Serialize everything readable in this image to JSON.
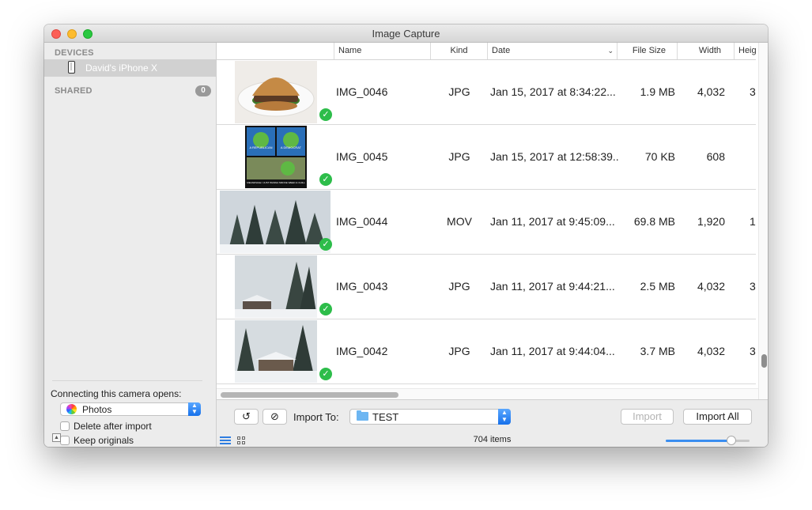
{
  "window": {
    "title": "Image Capture"
  },
  "sidebar": {
    "devices_heading": "DEVICES",
    "device_name": "David's iPhone X",
    "shared_heading": "SHARED",
    "shared_count": "0",
    "opens_label": "Connecting this camera opens:",
    "opens_app": "Photos",
    "delete_after_import": "Delete after import",
    "keep_originals": "Keep originals"
  },
  "table": {
    "columns": [
      "Name",
      "Kind",
      "Date",
      "File Size",
      "Width",
      "Heig"
    ],
    "rows": [
      {
        "name": "IMG_0046",
        "kind": "JPG",
        "date": "Jan 15, 2017 at 8:34:22...",
        "size": "1.9 MB",
        "width": "4,032",
        "height": "3"
      },
      {
        "name": "IMG_0045",
        "kind": "JPG",
        "date": "Jan 15, 2017 at 12:58:39...",
        "size": "70 KB",
        "width": "608",
        "height": ""
      },
      {
        "name": "IMG_0044",
        "kind": "MOV",
        "date": "Jan 11, 2017 at 9:45:09...",
        "size": "69.8 MB",
        "width": "1,920",
        "height": "1"
      },
      {
        "name": "IMG_0043",
        "kind": "JPG",
        "date": "Jan 11, 2017 at 9:44:21...",
        "size": "2.5 MB",
        "width": "4,032",
        "height": "3"
      },
      {
        "name": "IMG_0042",
        "kind": "JPG",
        "date": "Jan 11, 2017 at 9:44:04...",
        "size": "3.7 MB",
        "width": "4,032",
        "height": "3"
      }
    ]
  },
  "thumb_text": {
    "r1_tl": "I'M RIGHT CALL ME",
    "r1_a": "A REPUBLICAN",
    "r1_b": "A DEMOCRAT",
    "r1_bottom": "MEANWHILE I JUST WANNA SMOKE WEED & CHILL"
  },
  "footer": {
    "import_to_label": "Import To:",
    "folder": "TEST",
    "import_button": "Import",
    "import_all_button": "Import All",
    "item_count": "704 items",
    "thumbnail_size": 0.78
  },
  "colors": {
    "accent": "#2f7de1",
    "check_badge": "#2dbd4a",
    "selection": "#dcdcdc"
  }
}
